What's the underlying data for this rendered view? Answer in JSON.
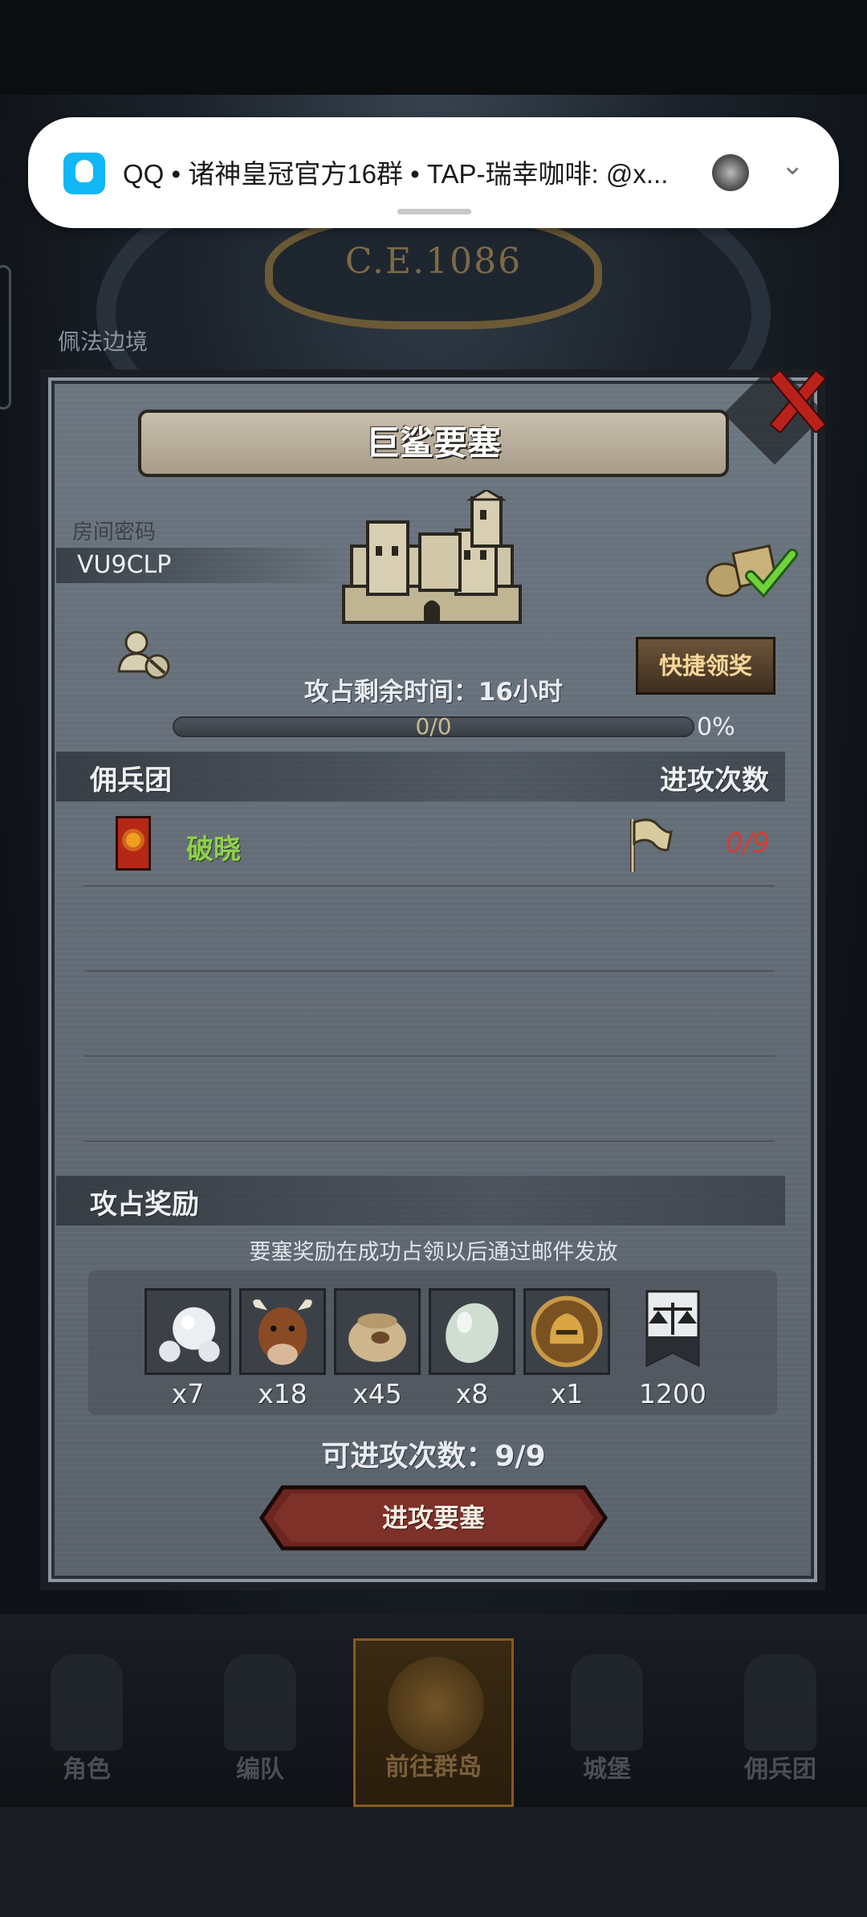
{
  "notification": {
    "text": "QQ • 诸神皇冠官方16群 • TAP-瑞幸咖啡: @x..."
  },
  "background": {
    "era": "C.E.1086",
    "region": "佩法边境"
  },
  "dialog": {
    "title": "巨鲨要塞",
    "room_code_label": "房间密码",
    "room_code": "VU9CLP",
    "quick_claim": "快捷领奖",
    "remaining_time": "攻占剩余时间：16小时",
    "progress": {
      "value": "0/0",
      "percent": "0%",
      "fraction": 0
    },
    "mercenary_header": "佣兵团",
    "attacks_header": "进攻次数",
    "guilds": [
      {
        "name": "破晓",
        "attacks": "0/9"
      }
    ],
    "rewards_header": "攻占奖励",
    "reward_note": "要塞奖励在成功占领以后通过邮件发放",
    "rewards": [
      {
        "icon": "pearls-icon",
        "qty": "x7"
      },
      {
        "icon": "cow-icon",
        "qty": "x18"
      },
      {
        "icon": "grain-sack-icon",
        "qty": "x45"
      },
      {
        "icon": "moonstone-icon",
        "qty": "x8"
      },
      {
        "icon": "knight-helmet-coin-icon",
        "qty": "x1"
      },
      {
        "icon": "justice-banner-icon",
        "qty": "1200"
      }
    ],
    "attack_times": "可进攻次数：9/9",
    "attack_button": "进攻要塞"
  },
  "bottom_nav": [
    {
      "label": "角色",
      "icon": "knight-icon"
    },
    {
      "label": "编队",
      "icon": "helmet-icon"
    },
    {
      "label": "前往群岛",
      "icon": "island-compass-icon",
      "active": true
    },
    {
      "label": "城堡",
      "icon": "castle-icon"
    },
    {
      "label": "佣兵团",
      "icon": "mercenary-icon"
    }
  ],
  "colors": {
    "guild_name": "#8ed14a",
    "attack_count": "#d63c34",
    "close": "#b9221b",
    "claim_text": "#f7d79a"
  }
}
